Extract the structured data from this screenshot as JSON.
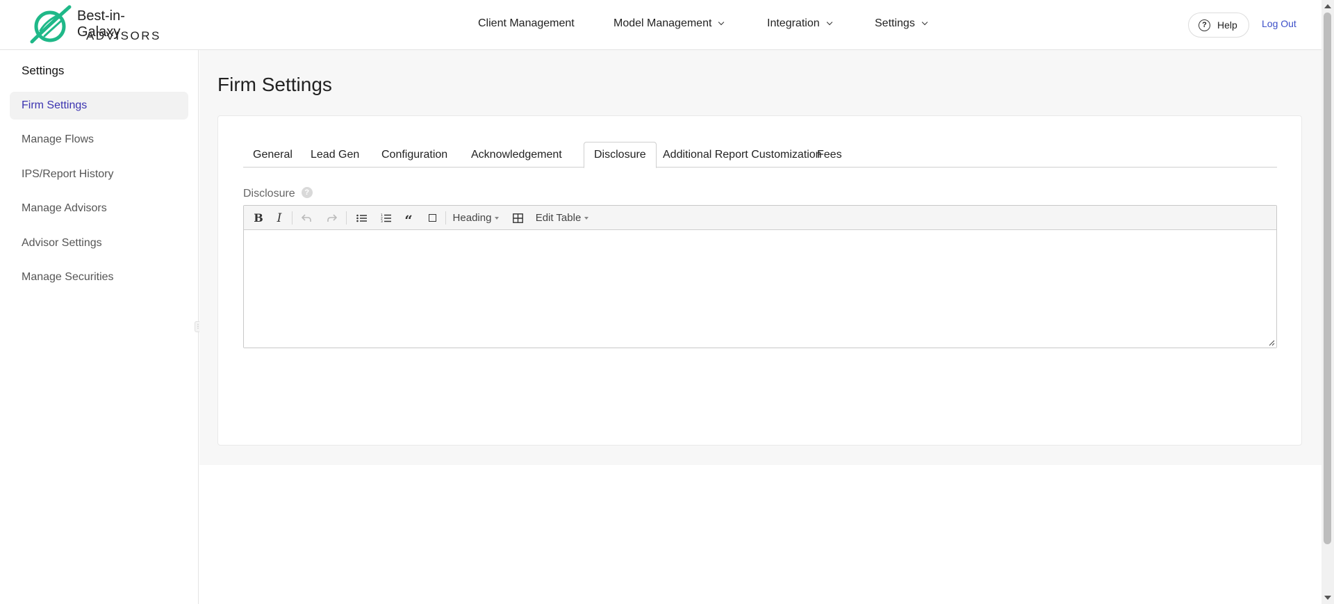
{
  "brand": {
    "line1": "Best-in-Galaxy",
    "line2": "ADVISORS",
    "accent": "#1fb888"
  },
  "nav": {
    "items": [
      {
        "label": "Client Management",
        "dropdown": false
      },
      {
        "label": "Model Management",
        "dropdown": true
      },
      {
        "label": "Integration",
        "dropdown": true
      },
      {
        "label": "Settings",
        "dropdown": true
      }
    ],
    "help_label": "Help",
    "logout_label": "Log Out"
  },
  "sidebar": {
    "title": "Settings",
    "items": [
      {
        "label": "Firm Settings",
        "active": true
      },
      {
        "label": "Manage Flows"
      },
      {
        "label": "IPS/Report History"
      },
      {
        "label": "Manage Advisors"
      },
      {
        "label": "Advisor Settings"
      },
      {
        "label": "Manage Securities"
      }
    ]
  },
  "main": {
    "title": "Firm Settings",
    "tabs": [
      {
        "label": "General"
      },
      {
        "label": "Lead Gen"
      },
      {
        "label": "Configuration"
      },
      {
        "label": "Acknowledgement"
      },
      {
        "label": "Disclosure",
        "active": true
      },
      {
        "label": "Additional Report Customization"
      },
      {
        "label": "Fees"
      }
    ],
    "field_label": "Disclosure",
    "field_help": "?",
    "editor": {
      "toolbar": {
        "bold": "B",
        "italic": "I",
        "heading_label": "Heading",
        "edit_table_label": "Edit Table"
      },
      "content": ""
    }
  }
}
